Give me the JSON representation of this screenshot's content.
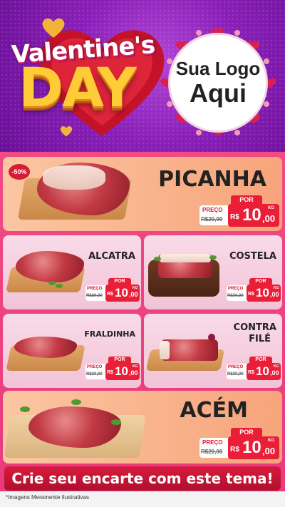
{
  "header": {
    "title_line1": "Valentine's",
    "title_line2": "DAY",
    "logo_line1": "Sua Logo",
    "logo_line2": "Aqui"
  },
  "products": [
    {
      "name": "PICANHA",
      "por": "POR",
      "preco_label": "PREÇO",
      "old_price": "R$20,00",
      "currency": "R$",
      "price_int": "10",
      "price_cents": ",00",
      "unit": "KG",
      "badge": "-50%"
    },
    {
      "name": "ALCATRA",
      "por": "POR",
      "preco_label": "PREÇO",
      "old_price": "R$20,00",
      "currency": "R$",
      "price_int": "10",
      "price_cents": ",00",
      "unit": "KG"
    },
    {
      "name": "COSTELA",
      "por": "POR",
      "preco_label": "PREÇO",
      "old_price": "R$20,00",
      "currency": "R$",
      "price_int": "10",
      "price_cents": ",00",
      "unit": "KG"
    },
    {
      "name": "FRALDINHA",
      "por": "POR",
      "preco_label": "PREÇO",
      "old_price": "R$20,00",
      "currency": "R$",
      "price_int": "10",
      "price_cents": ",00",
      "unit": "KG"
    },
    {
      "name_line1": "CONTRA",
      "name_line2": "FILÉ",
      "por": "POR",
      "preco_label": "PREÇO",
      "old_price": "R$20,00",
      "currency": "R$",
      "price_int": "10",
      "price_cents": ",00",
      "unit": "KG"
    },
    {
      "name": "ACÉM",
      "por": "POR",
      "preco_label": "PREÇO",
      "old_price": "R$20,00",
      "currency": "R$",
      "price_int": "10",
      "price_cents": ",00",
      "unit": "KG"
    }
  ],
  "cta": "Crie seu encarte com este tema!",
  "disclaimer": "*Imagens Meramente Ilustrativas",
  "colors": {
    "header_purple": "#8a1fb8",
    "content_pink": "#ec4280",
    "price_red": "#ea1e36",
    "day_gold": "#ffcc38"
  }
}
